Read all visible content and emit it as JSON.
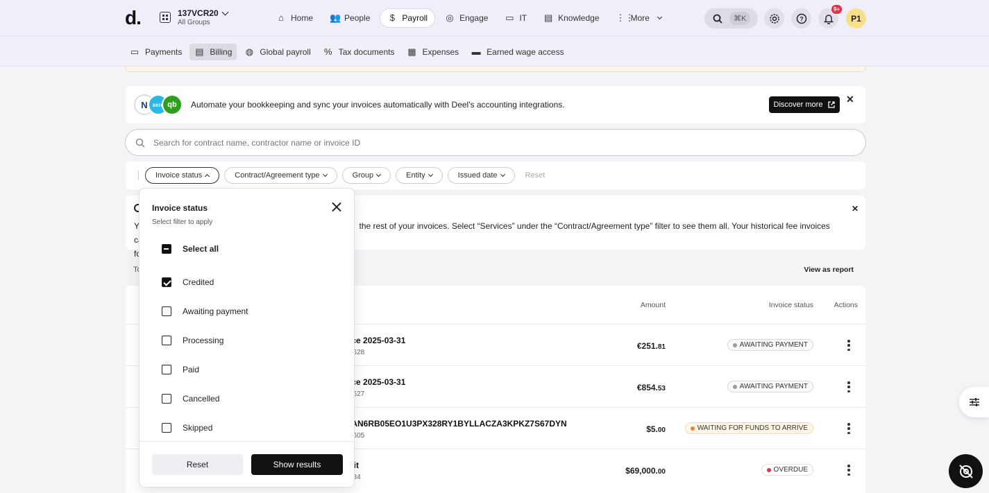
{
  "app": {
    "logo": "d."
  },
  "org": {
    "name": "137VCR20",
    "sub": "All Groups"
  },
  "nav": [
    {
      "label": "Home",
      "icon": "home-icon",
      "glyph": "⌂"
    },
    {
      "label": "People",
      "icon": "people-icon",
      "glyph": "👥"
    },
    {
      "label": "Payroll",
      "icon": "payroll-icon",
      "glyph": "$"
    },
    {
      "label": "Engage",
      "icon": "engage-icon",
      "glyph": "◎"
    },
    {
      "label": "IT",
      "icon": "laptop-icon",
      "glyph": "▭"
    },
    {
      "label": "Knowledge",
      "icon": "book-icon",
      "glyph": "▤"
    },
    {
      "label": "More",
      "icon": "grid-icon",
      "glyph": "⋮⋮"
    }
  ],
  "search_shortcut": "⌘K",
  "notifications_badge": "9+",
  "avatar_initials": "P1",
  "subnav": [
    {
      "label": "Payments",
      "icon": "card-icon",
      "glyph": "▭"
    },
    {
      "label": "Billing",
      "icon": "billing-icon",
      "glyph": "▤"
    },
    {
      "label": "Global payroll",
      "icon": "globe-icon",
      "glyph": "◍"
    },
    {
      "label": "Tax documents",
      "icon": "percent-icon",
      "glyph": "%"
    },
    {
      "label": "Expenses",
      "icon": "receipt-icon",
      "glyph": "▦"
    },
    {
      "label": "Earned wage access",
      "icon": "wallet-icon",
      "glyph": "▬"
    }
  ],
  "promo": {
    "logo_xero": "xero",
    "logo_qb": "qb",
    "text": "Automate your bookkeeping and sync your invoices automatically with Deel's accounting integrations.",
    "button": "Discover more"
  },
  "search": {
    "placeholder": "Search for contract name, contractor name or invoice ID"
  },
  "filters": {
    "chips": [
      "Invoice status",
      "Contract/Agreement type",
      "Group",
      "Entity",
      "Issued date"
    ],
    "reset": "Reset"
  },
  "info": {
    "text_start": "Y",
    "text_visible": "the rest of your invoices. Select “Services” under the “Contract/Agreement type” filter to see them all. Your historical fee invoices can still be",
    "text_line2": "fo"
  },
  "table": {
    "left_label": "To",
    "view_report": "View as report",
    "headers": {
      "amount": "Amount",
      "status": "Invoice status",
      "actions": "Actions"
    },
    "rows": [
      {
        "title": "ice 2025-03-31",
        "sub": "9628",
        "amount_main": "€251.",
        "amount_cents": "81",
        "status": "AWAITING PAYMENT",
        "kind": ""
      },
      {
        "title": "ice 2025-03-31",
        "sub": "9627",
        "amount_main": "€854.",
        "amount_cents": "53",
        "status": "AWAITING PAYMENT",
        "kind": ""
      },
      {
        "title": "IAN6RB05EO1U3PX328RY1BYLLACZA3KPKZ7S67DYN",
        "sub": "5605",
        "amount_main": "$5.",
        "amount_cents": "00",
        "status": "WAITING FOR FUNDS TO ARRIVE",
        "kind": "warn"
      },
      {
        "title": "sit",
        "sub": "384",
        "amount_main": "$69,000.",
        "amount_cents": "00",
        "status": "OVERDUE",
        "kind": "over"
      }
    ]
  },
  "dropdown": {
    "title": "Invoice status",
    "subtitle": "Select filter to apply",
    "select_all": "Select all",
    "options": [
      {
        "label": "Credited",
        "checked": true
      },
      {
        "label": "Awaiting payment",
        "checked": false
      },
      {
        "label": "Processing",
        "checked": false
      },
      {
        "label": "Paid",
        "checked": false
      },
      {
        "label": "Cancelled",
        "checked": false
      },
      {
        "label": "Skipped",
        "checked": false
      }
    ],
    "reset": "Reset",
    "show_results": "Show results"
  },
  "colors": {
    "accent_dark": "#111111",
    "overdue": "#e0334a",
    "warning": "#f0803c",
    "badge": "#e0334a"
  }
}
